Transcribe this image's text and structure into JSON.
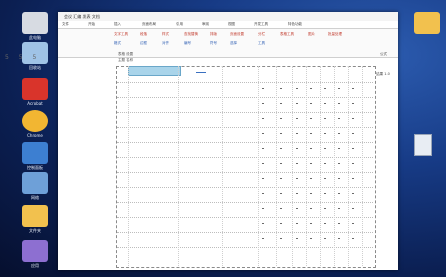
{
  "titlebar": {
    "title": "会议 汇编 发表 文档"
  },
  "ribbon": {
    "tabs": [
      "文件",
      "开始",
      "插入",
      "页面布局",
      "引用",
      "审阅",
      "视图",
      "开发工具",
      "特色功能"
    ],
    "row1": [
      "文字工具",
      "段落",
      "样式",
      "查找替换",
      "排版",
      "页面设置",
      "分栏",
      "表格工具",
      "图片",
      "批量处理"
    ],
    "row2": [
      "格式",
      "边框",
      "对齐",
      "编号",
      "符号",
      "选择",
      "工具"
    ]
  },
  "desktop": {
    "icons": [
      {
        "label": "此电脑",
        "color": "#d7dbe2"
      },
      {
        "label": "回收站",
        "color": "#9fc3e6"
      },
      {
        "label": "Acrobat",
        "color": "#d9342b"
      },
      {
        "label": "Chrome",
        "color": "#f2b632"
      },
      {
        "label": "控制面板",
        "color": "#3d7fd1"
      },
      {
        "label": "网络",
        "color": "#6ea0d8"
      },
      {
        "label": "文件夹",
        "color": "#f2c14e"
      },
      {
        "label": "应用",
        "color": "#8d6fd1"
      }
    ]
  },
  "document": {
    "margin_numbers": "5 5 5",
    "header_left": "表格 设置",
    "header_sub": "主题 名称",
    "right_label_top": "公式",
    "right_label_mid": "计算 结果 1.0"
  }
}
